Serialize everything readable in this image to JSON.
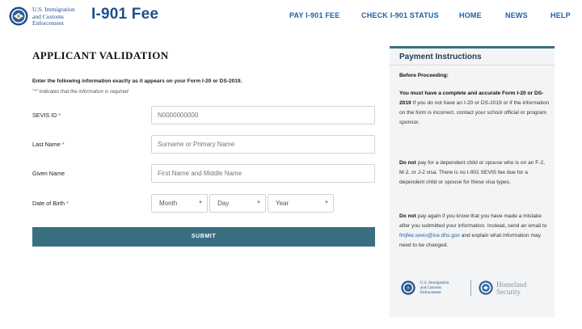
{
  "header": {
    "agency_lines": [
      "U.S. Immigration",
      "and Customs",
      "Enforcement"
    ],
    "brand": "I-901 Fee",
    "nav": [
      {
        "label": "PAY I-901 FEE"
      },
      {
        "label": "CHECK I-901 STATUS"
      },
      {
        "label": "HOME"
      },
      {
        "label": "NEWS"
      },
      {
        "label": "HELP"
      }
    ]
  },
  "form": {
    "title": "APPLICANT VALIDATION",
    "instructions": "Enter the following information exactly as it appears on your Form I-20 or DS-2019.",
    "required_note_star": "\"*\"",
    "required_note_text": " Indicates that the information is required",
    "fields": {
      "sevis": {
        "label": "SEVIS ID",
        "required_mark": "*",
        "placeholder": "N0000000000",
        "value": ""
      },
      "last_name": {
        "label": "Last Name",
        "required_mark": "*",
        "placeholder": "Surname or Primary Name",
        "value": ""
      },
      "given_name": {
        "label": "Given Name",
        "placeholder": "First Name and Middle Name",
        "value": ""
      },
      "dob": {
        "label": "Date of Birth",
        "required_mark": "*",
        "month": "Month",
        "day": "Day",
        "year": "Year"
      }
    },
    "submit_label": "SUBMIT"
  },
  "panel": {
    "title": "Payment Instructions",
    "before": "Before Proceeding:",
    "p1_bold": "You must have a complete and accurate Form I-20 or DS-2019",
    "p1_rest": " If you do not have an I-20 or DS-2019 or if the information on the form is incorrect, contact your school official or program sponsor.",
    "p2_bold": "Do not",
    "p2_rest": " pay for a dependent child or spouse who is on an F-2, M-2, or J-2 visa. There is no I-901 SEVIS fee due for a dependent child or spouse for these visa types.",
    "p3_bold": "Do not",
    "p3_rest1": " pay again if you know that you have made a mistake after you submitted your information. Instead, send an email to ",
    "p3_link": "fmjfee.sevis@ice.dhs.gov",
    "p3_rest2": " and explain what information may need to be changed.",
    "footer_ice_lines": [
      "U.S. Immigration",
      "and Customs",
      "Enforcement"
    ],
    "footer_dhs_lines": [
      "Homeland",
      "Security"
    ]
  },
  "colors": {
    "brand": "#1d4f91",
    "accent": "#3a6f82",
    "required": "#c0392b"
  }
}
